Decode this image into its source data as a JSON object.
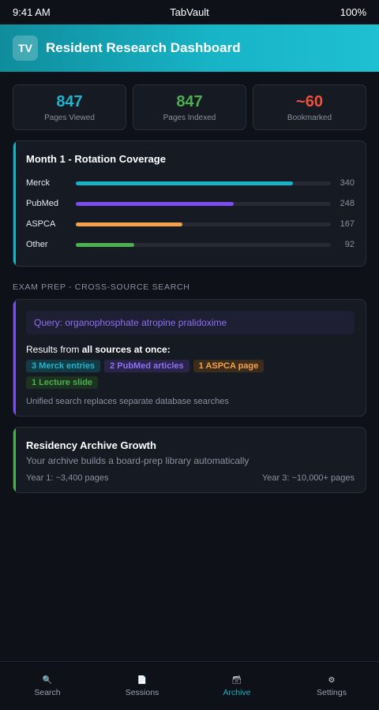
{
  "status_bar": {
    "time": "9:41 AM",
    "app_name": "TabVault",
    "battery": "100%"
  },
  "header": {
    "logo_text": "TV",
    "title": "Resident Research Dashboard"
  },
  "stats": [
    {
      "value": "847",
      "label": "Pages Viewed",
      "color": "#1fb5cf"
    },
    {
      "value": "847",
      "label": "Pages Indexed",
      "color": "#4caf50"
    },
    {
      "value": "~60",
      "label": "Bookmarked",
      "color": "#f0503c"
    }
  ],
  "coverage": {
    "title": "Month 1 - Rotation Coverage",
    "accent": "#17b3c6",
    "max": 400,
    "rows": [
      {
        "label": "Merck",
        "value": 340,
        "display": "340",
        "color": "#17b3c6"
      },
      {
        "label": "PubMed",
        "value": 248,
        "display": "248",
        "color": "#7b4cf0"
      },
      {
        "label": "ASPCA",
        "value": 167,
        "display": "167",
        "color": "#f5a04a"
      },
      {
        "label": "Other",
        "value": 92,
        "display": "92",
        "color": "#4caf50"
      }
    ]
  },
  "exam_prep": {
    "heading": "EXAM PREP - CROSS-SOURCE SEARCH",
    "accent": "#7b4cf0",
    "query": "Query: organophosphate atropine pralidoxime",
    "results_prefix": "Results from ",
    "results_bold": "all sources at once:",
    "tags": [
      {
        "text": "3 Merck entries",
        "color": "#1fb5cf",
        "bg": "#143a44"
      },
      {
        "text": "2 PubMed articles",
        "color": "#8d6ff7",
        "bg": "#2a2448"
      },
      {
        "text": "1 ASPCA page",
        "color": "#f5a04a",
        "bg": "#3b2c1c"
      },
      {
        "text": "1 Lecture slide",
        "color": "#4caf50",
        "bg": "#1c3320"
      }
    ],
    "note": "Unified search replaces separate database searches"
  },
  "growth": {
    "title": "Residency Archive Growth",
    "accent": "#4caf50",
    "subtitle": "Your archive builds a board-prep library automatically",
    "year1": "Year 1: ~3,400 pages",
    "year3": "Year 3: ~10,000+ pages"
  },
  "bottom_nav": [
    {
      "label": "Search",
      "icon": "magnifier-icon",
      "glyph": "🔍",
      "active": false
    },
    {
      "label": "Sessions",
      "icon": "document-icon",
      "glyph": "📄",
      "active": false
    },
    {
      "label": "Archive",
      "icon": "archive-box-icon",
      "glyph": "🗃",
      "active": true
    },
    {
      "label": "Settings",
      "icon": "gear-icon",
      "glyph": "⚙",
      "active": false
    }
  ]
}
